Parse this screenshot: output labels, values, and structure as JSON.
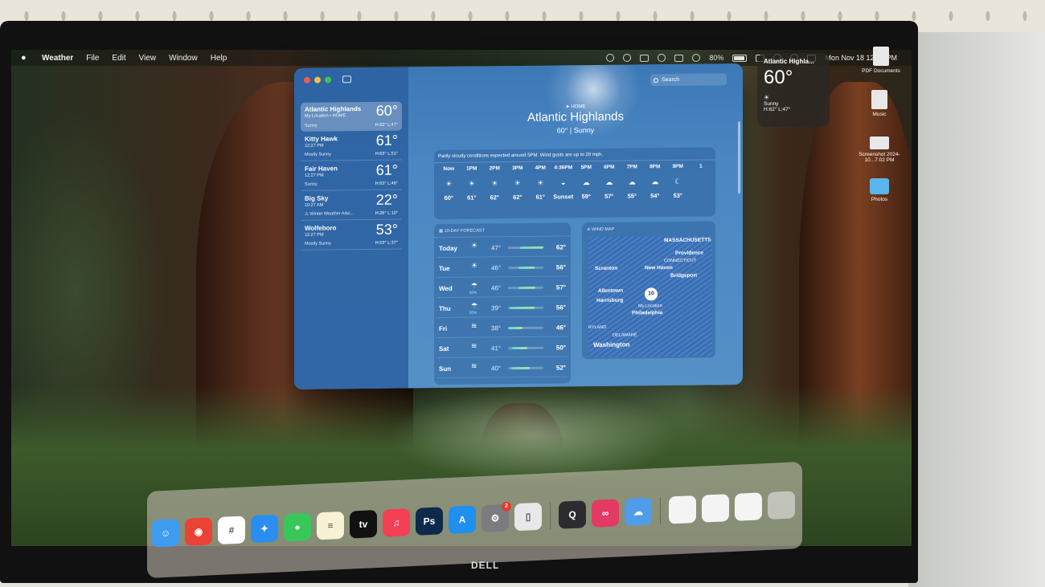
{
  "menubar": {
    "app_name": "Weather",
    "menus": [
      "File",
      "Edit",
      "View",
      "Window",
      "Help"
    ],
    "battery": "80%",
    "datetime": "Mon Nov 18  12:27 PM"
  },
  "sidebar": {
    "locations": [
      {
        "name": "Atlantic Highlands",
        "sub": "My Location • HOME",
        "condition": "Sunny",
        "temp": "60°",
        "hilo": "H:62° L:47°"
      },
      {
        "name": "Kitty Hawk",
        "sub": "12:27 PM",
        "condition": "Mostly Sunny",
        "temp": "61°",
        "hilo": "H:63° L:51°"
      },
      {
        "name": "Fair Haven",
        "sub": "12:27 PM",
        "condition": "Sunny",
        "temp": "61°",
        "hilo": "H:63° L:46°"
      },
      {
        "name": "Big Sky",
        "sub": "10:27 AM",
        "condition": "⚠ Winter Weather Advi...",
        "temp": "22°",
        "hilo": "H:26° L:10°"
      },
      {
        "name": "Wolfeboro",
        "sub": "12:27 PM",
        "condition": "Mostly Sunny",
        "temp": "53°",
        "hilo": "H:53° L:37°"
      }
    ]
  },
  "main": {
    "search_placeholder": "Search",
    "home_label": "HOME",
    "city": "Atlantic Highlands",
    "current": "60°  |  Sunny",
    "hourly_summary": "Partly cloudy conditions expected around 5PM. Wind gusts are up to 20 mph.",
    "hours": [
      {
        "label": "Now",
        "icon": "sun",
        "temp": "60°"
      },
      {
        "label": "1PM",
        "icon": "sun",
        "temp": "61°"
      },
      {
        "label": "2PM",
        "icon": "sun",
        "temp": "62°"
      },
      {
        "label": "3PM",
        "icon": "sun",
        "temp": "62°"
      },
      {
        "label": "4PM",
        "icon": "sun",
        "temp": "61°"
      },
      {
        "label": "4:36PM",
        "icon": "sunset",
        "temp": "Sunset"
      },
      {
        "label": "5PM",
        "icon": "cloud",
        "temp": "59°"
      },
      {
        "label": "6PM",
        "icon": "cloud",
        "temp": "57°"
      },
      {
        "label": "7PM",
        "icon": "cloud",
        "temp": "55°"
      },
      {
        "label": "8PM",
        "icon": "cloud",
        "temp": "54°"
      },
      {
        "label": "9PM",
        "icon": "moon-cloud",
        "temp": "53°"
      },
      {
        "label": "1",
        "icon": "",
        "temp": ""
      }
    ],
    "forecast_title": "10-DAY FORECAST",
    "forecast": [
      {
        "day": "Today",
        "icon": "sun",
        "pop": "",
        "lo": "47°",
        "hi": "62°",
        "range_start": 0.35,
        "range_end": 1.0
      },
      {
        "day": "Tue",
        "icon": "sun",
        "pop": "",
        "lo": "46°",
        "hi": "56°",
        "range_start": 0.3,
        "range_end": 0.75
      },
      {
        "day": "Wed",
        "icon": "rain",
        "pop": "65%",
        "lo": "46°",
        "hi": "57°",
        "range_start": 0.3,
        "range_end": 0.78
      },
      {
        "day": "Thu",
        "icon": "rain",
        "pop": "95%",
        "lo": "39°",
        "hi": "56°",
        "range_start": 0.05,
        "range_end": 0.75
      },
      {
        "day": "Fri",
        "icon": "wind",
        "pop": "",
        "lo": "38°",
        "hi": "46°",
        "range_start": 0.0,
        "range_end": 0.4
      },
      {
        "day": "Sat",
        "icon": "wind",
        "pop": "",
        "lo": "41°",
        "hi": "50°",
        "range_start": 0.12,
        "range_end": 0.55
      },
      {
        "day": "Sun",
        "icon": "wind",
        "pop": "",
        "lo": "40°",
        "hi": "52°",
        "range_start": 0.08,
        "range_end": 0.62
      }
    ],
    "windmap_title": "WIND MAP",
    "map_labels": {
      "massachusetts": "MASSACHUSETTS",
      "providence": "Providence",
      "connecticut": "CONNECTICUT",
      "scranton": "Scranton",
      "new_haven": "New Haven",
      "bridgeport": "Bridgeport",
      "allentown": "Allentown",
      "harrisburg": "Harrisburg",
      "pin_value": "10",
      "my_location": "My Location",
      "philadelphia": "Philadelphia",
      "ryland": "RYLAND",
      "delaware": "DELAWARE",
      "washington": "Washington"
    }
  },
  "widget": {
    "location": "Atlantic Highla...",
    "temp": "60°",
    "condition": "Sunny",
    "hilo": "H:62° L:47°"
  },
  "desktop_icons": [
    {
      "label": "PDF Documents"
    },
    {
      "label": "Music"
    },
    {
      "label": "Screenshot 2024-10...7.02 PM"
    },
    {
      "label": "Photos"
    }
  ],
  "dock": {
    "apps": [
      {
        "name": "Finder",
        "icon": "finder-icon",
        "color": "#3d9bf0",
        "glyph": "☺"
      },
      {
        "name": "Chrome",
        "icon": "chrome-icon",
        "color": "#e94335",
        "glyph": "◉"
      },
      {
        "name": "Slack",
        "icon": "slack-icon",
        "color": "#ffffff",
        "glyph": "#"
      },
      {
        "name": "Safari",
        "icon": "safari-icon",
        "color": "#2a8ef0",
        "glyph": "✦"
      },
      {
        "name": "Messages",
        "icon": "messages-icon",
        "color": "#38c85a",
        "glyph": "●"
      },
      {
        "name": "Notes",
        "icon": "notes-icon",
        "color": "#f7f2d6",
        "glyph": "≡"
      },
      {
        "name": "Apple TV",
        "icon": "appletv-icon",
        "color": "#111111",
        "glyph": "tv"
      },
      {
        "name": "Music",
        "icon": "music-icon",
        "color": "#f43f55",
        "glyph": "♫"
      },
      {
        "name": "Photoshop",
        "icon": "photoshop-icon",
        "color": "#0e2a4b",
        "glyph": "Ps"
      },
      {
        "name": "App Store",
        "icon": "appstore-icon",
        "color": "#1f8ff0",
        "glyph": "A"
      },
      {
        "name": "System Settings",
        "icon": "settings-icon",
        "color": "#7c7c80",
        "glyph": "⚙",
        "badge": "2"
      },
      {
        "name": "iPhone Mirroring",
        "icon": "iphone-mirroring-icon",
        "color": "#e8e8ea",
        "glyph": "▯"
      }
    ],
    "apps2": [
      {
        "name": "QuickTime",
        "icon": "quicktime-icon",
        "color": "#2c2c30",
        "glyph": "Q"
      },
      {
        "name": "Creative Cloud",
        "icon": "creative-cloud-icon",
        "color": "#e33a64",
        "glyph": "∞"
      },
      {
        "name": "Weather",
        "icon": "weather-icon",
        "color": "#4f9ce8",
        "glyph": "☁"
      }
    ]
  },
  "brand": "DELL"
}
